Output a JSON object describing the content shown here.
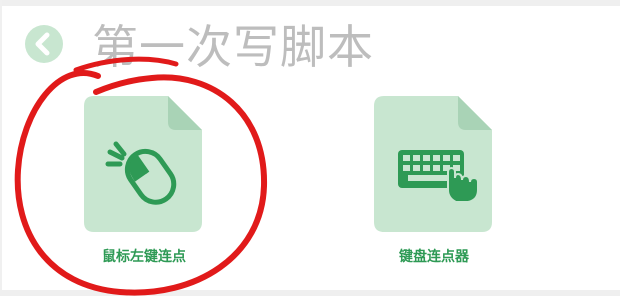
{
  "header": {
    "title": "第一次写脚本",
    "back_icon": "chevron-left-icon"
  },
  "cards": [
    {
      "label": "鼠标左键连点",
      "icon": "mouse-click-icon"
    },
    {
      "label": "键盘连点器",
      "icon": "keyboard-tap-icon"
    }
  ],
  "colors": {
    "accent_green": "#2e9a55",
    "card_bg": "#c8e6d0",
    "card_fold": "#a9d3b6",
    "title_gray": "#bdbdbd",
    "annotation_red": "#e11a1a"
  }
}
